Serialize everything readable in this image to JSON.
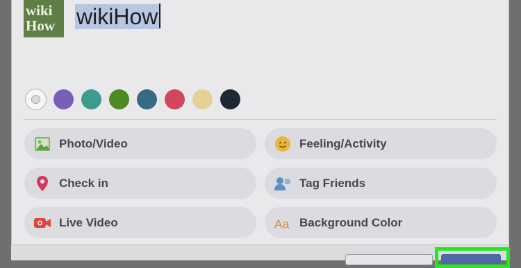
{
  "composer": {
    "avatar_line1": "wiki",
    "avatar_line2": "How",
    "status_text": "wikiHow"
  },
  "backgrounds": {
    "swatch_colors": [
      "#f6f6f7",
      "#7a5fb8",
      "#3d9b8f",
      "#4d8a24",
      "#376a86",
      "#d2475a",
      "#e6d195",
      "#1f2835"
    ],
    "selected_index": 0
  },
  "actions": [
    {
      "label": "Photo/Video",
      "icon": "photo-icon"
    },
    {
      "label": "Feeling/Activity",
      "icon": "smiley-icon"
    },
    {
      "label": "Check in",
      "icon": "location-pin-icon"
    },
    {
      "label": "Tag Friends",
      "icon": "tag-friends-icon"
    },
    {
      "label": "Live Video",
      "icon": "live-video-icon"
    },
    {
      "label": "Background Color",
      "icon": "text-aa-icon"
    }
  ],
  "colors": {
    "highlight": "#22e81f",
    "post_button": "#4d69a6"
  }
}
